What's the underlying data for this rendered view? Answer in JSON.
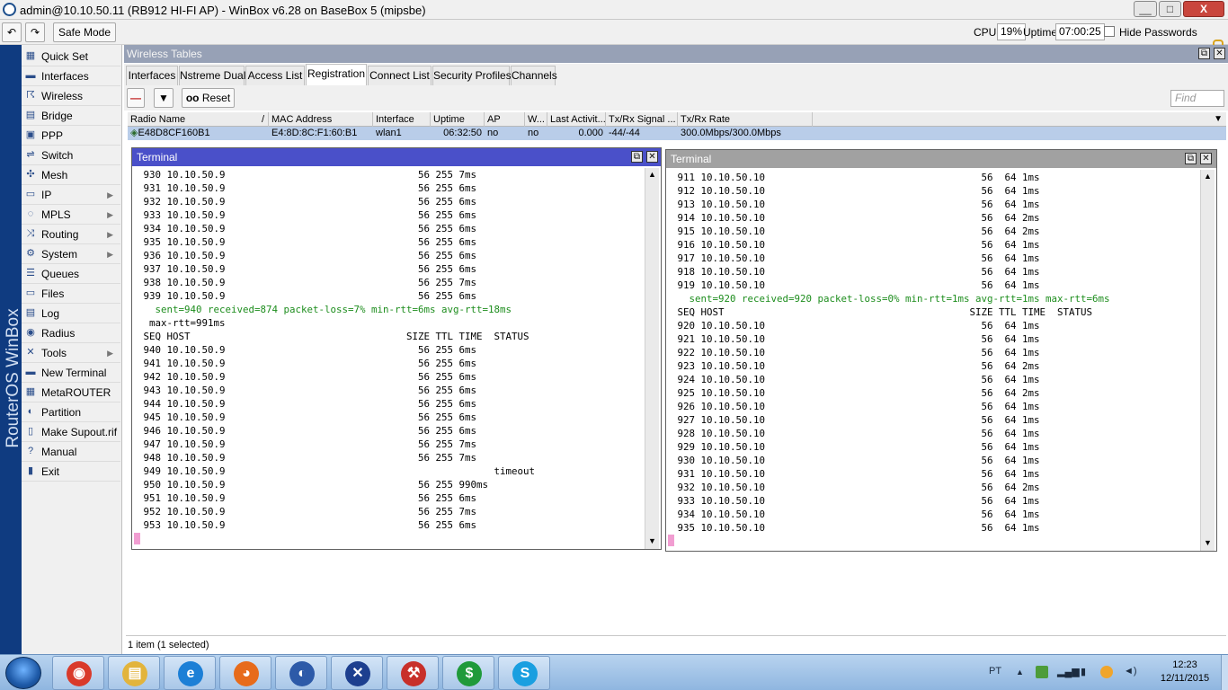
{
  "window": {
    "title": "admin@10.10.50.11 (RB912 HI-FI AP) - WinBox v6.28 on BaseBox 5 (mipsbe)",
    "minimize": "__",
    "maximize": "□",
    "close": "X"
  },
  "toolbar": {
    "undo": "↶",
    "redo": "↷",
    "safe_mode": "Safe Mode",
    "cpu_label": "CPU:",
    "cpu_value": "19%",
    "uptime_label": "Uptime:",
    "uptime_value": "07:00:25",
    "hide_passwords": "Hide Passwords"
  },
  "brand": "RouterOS WinBox",
  "sidebar": {
    "items": [
      {
        "label": "Quick Set",
        "icon": "quick-set-icon",
        "glyph": "▦"
      },
      {
        "label": "Interfaces",
        "icon": "interfaces-icon",
        "glyph": "▬"
      },
      {
        "label": "Wireless",
        "icon": "wireless-icon",
        "glyph": "☈"
      },
      {
        "label": "Bridge",
        "icon": "bridge-icon",
        "glyph": "▤"
      },
      {
        "label": "PPP",
        "icon": "ppp-icon",
        "glyph": "▣"
      },
      {
        "label": "Switch",
        "icon": "switch-icon",
        "glyph": "⇌"
      },
      {
        "label": "Mesh",
        "icon": "mesh-icon",
        "glyph": "✣"
      },
      {
        "label": "IP",
        "icon": "ip-icon",
        "glyph": "▭",
        "submenu": "▶"
      },
      {
        "label": "MPLS",
        "icon": "mpls-icon",
        "glyph": "◌",
        "submenu": "▶"
      },
      {
        "label": "Routing",
        "icon": "routing-icon",
        "glyph": "⤨",
        "submenu": "▶"
      },
      {
        "label": "System",
        "icon": "system-icon",
        "glyph": "⚙",
        "submenu": "▶"
      },
      {
        "label": "Queues",
        "icon": "queues-icon",
        "glyph": "☰"
      },
      {
        "label": "Files",
        "icon": "files-icon",
        "glyph": "▭"
      },
      {
        "label": "Log",
        "icon": "log-icon",
        "glyph": "▤"
      },
      {
        "label": "Radius",
        "icon": "radius-icon",
        "glyph": "◉"
      },
      {
        "label": "Tools",
        "icon": "tools-icon",
        "glyph": "✕",
        "submenu": "▶"
      },
      {
        "label": "New Terminal",
        "icon": "terminal-icon",
        "glyph": "▬"
      },
      {
        "label": "MetaROUTER",
        "icon": "metarouter-icon",
        "glyph": "▦"
      },
      {
        "label": "Partition",
        "icon": "partition-icon",
        "glyph": "◐"
      },
      {
        "label": "Make Supout.rif",
        "icon": "supout-icon",
        "glyph": "▯"
      },
      {
        "label": "Manual",
        "icon": "manual-icon",
        "glyph": "?"
      },
      {
        "label": "Exit",
        "icon": "exit-icon",
        "glyph": "▮"
      }
    ]
  },
  "panel": {
    "title": "Wireless Tables",
    "restore": "⧉",
    "close": "✕",
    "tabs": [
      "Interfaces",
      "Nstreme Dual",
      "Access List",
      "Registration",
      "Connect List",
      "Security Profiles",
      "Channels"
    ],
    "active_tab": 3,
    "remove": "—",
    "filter": "▼",
    "reset_icon": "oo",
    "reset": "Reset",
    "find_placeholder": "Find",
    "columns": [
      "Radio Name",
      "MAC Address",
      "Interface",
      "Uptime",
      "AP",
      "W...",
      "Last Activit...",
      "Tx/Rx Signal ...",
      "Tx/Rx Rate"
    ],
    "sort_indicator": "/",
    "row": {
      "radio_name": "E48D8CF160B1",
      "mac": "E4:8D:8C:F1:60:B1",
      "interface": "wlan1",
      "uptime": "06:32:50",
      "ap": "no",
      "w": "no",
      "last_activity": "0.000",
      "signal": "-44/-44",
      "rate": "300.0Mbps/300.0Mbps"
    },
    "status": "1 item (1 selected)"
  },
  "terminal1": {
    "title": "Terminal",
    "lines": [
      " 930 10.10.50.9                                 56 255 7ms",
      " 931 10.10.50.9                                 56 255 6ms",
      " 932 10.10.50.9                                 56 255 6ms",
      " 933 10.10.50.9                                 56 255 6ms",
      " 934 10.10.50.9                                 56 255 6ms",
      " 935 10.10.50.9                                 56 255 6ms",
      " 936 10.10.50.9                                 56 255 6ms",
      " 937 10.10.50.9                                 56 255 6ms",
      " 938 10.10.50.9                                 56 255 7ms",
      " 939 10.10.50.9                                 56 255 6ms",
      "   sent=940 received=874 packet-loss=7% min-rtt=6ms avg-rtt=18ms",
      "  max-rtt=991ms",
      " SEQ HOST                                     SIZE TTL TIME  STATUS",
      " 940 10.10.50.9                                 56 255 6ms",
      " 941 10.10.50.9                                 56 255 6ms",
      " 942 10.10.50.9                                 56 255 6ms",
      " 943 10.10.50.9                                 56 255 6ms",
      " 944 10.10.50.9                                 56 255 6ms",
      " 945 10.10.50.9                                 56 255 6ms",
      " 946 10.10.50.9                                 56 255 6ms",
      " 947 10.10.50.9                                 56 255 7ms",
      " 948 10.10.50.9                                 56 255 7ms",
      " 949 10.10.50.9                                              timeout",
      " 950 10.10.50.9                                 56 255 990ms",
      " 951 10.10.50.9                                 56 255 6ms",
      " 952 10.10.50.9                                 56 255 7ms",
      " 953 10.10.50.9                                 56 255 6ms"
    ],
    "stats_line": 10,
    "stats_line2": 11
  },
  "terminal2": {
    "title": "Terminal",
    "lines": [
      " 911 10.10.50.10                                     56  64 1ms",
      " 912 10.10.50.10                                     56  64 1ms",
      " 913 10.10.50.10                                     56  64 1ms",
      " 914 10.10.50.10                                     56  64 2ms",
      " 915 10.10.50.10                                     56  64 2ms",
      " 916 10.10.50.10                                     56  64 1ms",
      " 917 10.10.50.10                                     56  64 1ms",
      " 918 10.10.50.10                                     56  64 1ms",
      " 919 10.10.50.10                                     56  64 1ms",
      "   sent=920 received=920 packet-loss=0% min-rtt=1ms avg-rtt=1ms max-rtt=6ms",
      " SEQ HOST                                          SIZE TTL TIME  STATUS",
      " 920 10.10.50.10                                     56  64 1ms",
      " 921 10.10.50.10                                     56  64 1ms",
      " 922 10.10.50.10                                     56  64 1ms",
      " 923 10.10.50.10                                     56  64 2ms",
      " 924 10.10.50.10                                     56  64 1ms",
      " 925 10.10.50.10                                     56  64 2ms",
      " 926 10.10.50.10                                     56  64 1ms",
      " 927 10.10.50.10                                     56  64 1ms",
      " 928 10.10.50.10                                     56  64 1ms",
      " 929 10.10.50.10                                     56  64 1ms",
      " 930 10.10.50.10                                     56  64 1ms",
      " 931 10.10.50.10                                     56  64 1ms",
      " 932 10.10.50.10                                     56  64 2ms",
      " 933 10.10.50.10                                     56  64 1ms",
      " 934 10.10.50.10                                     56  64 1ms",
      " 935 10.10.50.10                                     56  64 1ms"
    ],
    "stats_line": 9
  },
  "taskbar": {
    "apps": [
      {
        "name": "chrome-icon",
        "glyph": "◉",
        "color": "#d93a2b"
      },
      {
        "name": "file-explorer-icon",
        "glyph": "▤",
        "color": "#e2b43c"
      },
      {
        "name": "internet-explorer-icon",
        "glyph": "e",
        "color": "#1c7fd6"
      },
      {
        "name": "firefox-icon",
        "glyph": "◕",
        "color": "#e76b1b"
      },
      {
        "name": "winbox-icon",
        "glyph": "◐",
        "color": "#2d5aa8"
      },
      {
        "name": "app-x-icon",
        "glyph": "✕",
        "color": "#1d3f8f"
      },
      {
        "name": "tools-app-icon",
        "glyph": "⚒",
        "color": "#c8302a"
      },
      {
        "name": "money-app-icon",
        "glyph": "$",
        "color": "#1f9a3a"
      },
      {
        "name": "skype-icon",
        "glyph": "S",
        "color": "#1a9fe0"
      }
    ],
    "lang": "PT",
    "tray_up": "▲",
    "clock_time": "12:23",
    "clock_date": "12/11/2015"
  },
  "colors": {
    "terminal1_title": "#4a50c9",
    "terminal2_title": "#a1a1a1",
    "selected_row": "#b9cde9",
    "stats_text": "#1d8d1d",
    "brand_strip": "#0f3b80"
  }
}
